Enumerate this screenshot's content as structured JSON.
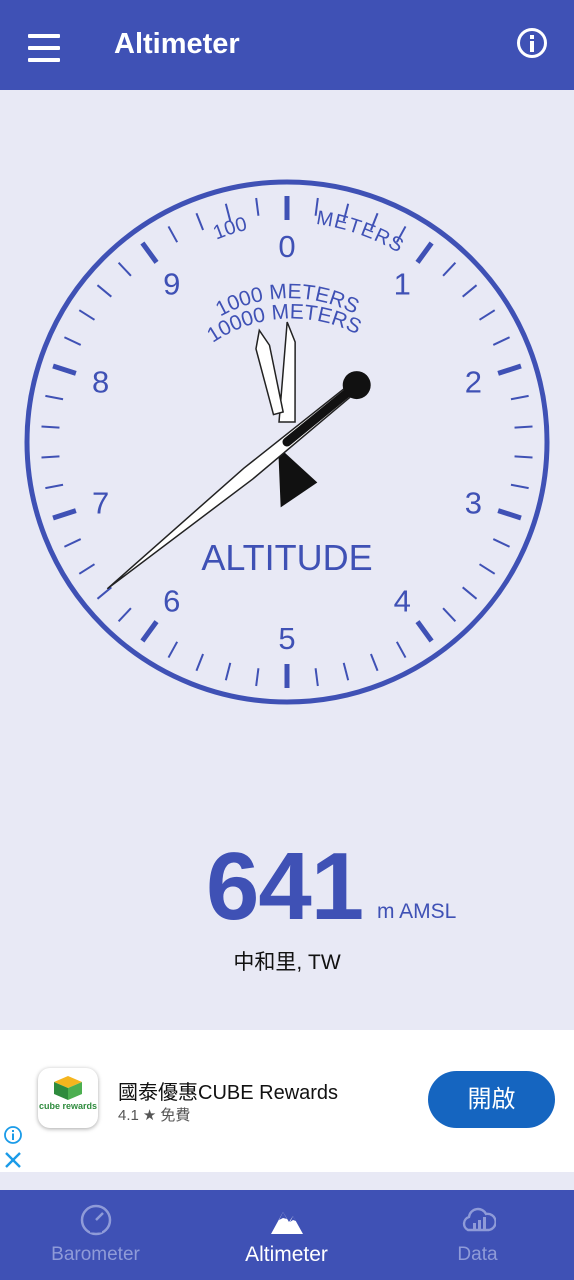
{
  "app_bar": {
    "title": "Altimeter",
    "menu_icon": "hamburger-menu-icon",
    "info_icon": "info-icon"
  },
  "gauge": {
    "dial_numbers": [
      "0",
      "1",
      "2",
      "3",
      "4",
      "5",
      "6",
      "7",
      "8",
      "9"
    ],
    "scale_label_100": "100",
    "label_meters": "METERS",
    "label_1000": "1000 METERS",
    "label_10000": "10000 METERS",
    "label_center": "ALTITUDE",
    "altitude_m": 641
  },
  "reading": {
    "value": "641",
    "unit": "m AMSL",
    "location": "中和里, TW"
  },
  "ad": {
    "logo_text": "cube rewards",
    "title": "國泰優惠CUBE Rewards",
    "rating": "4.1",
    "star": "★",
    "price": "免費",
    "button_label": "開啟"
  },
  "bottom_nav": {
    "items": [
      {
        "label": "Barometer",
        "icon": "gauge-icon"
      },
      {
        "label": "Altimeter",
        "icon": "mountain-icon"
      },
      {
        "label": "Data",
        "icon": "cloud-chart-icon"
      }
    ]
  },
  "colors": {
    "primary": "#3f51b5",
    "background": "#e8e9f5",
    "ad_button": "#1565c0",
    "nav_inactive": "#8f9bd8"
  }
}
